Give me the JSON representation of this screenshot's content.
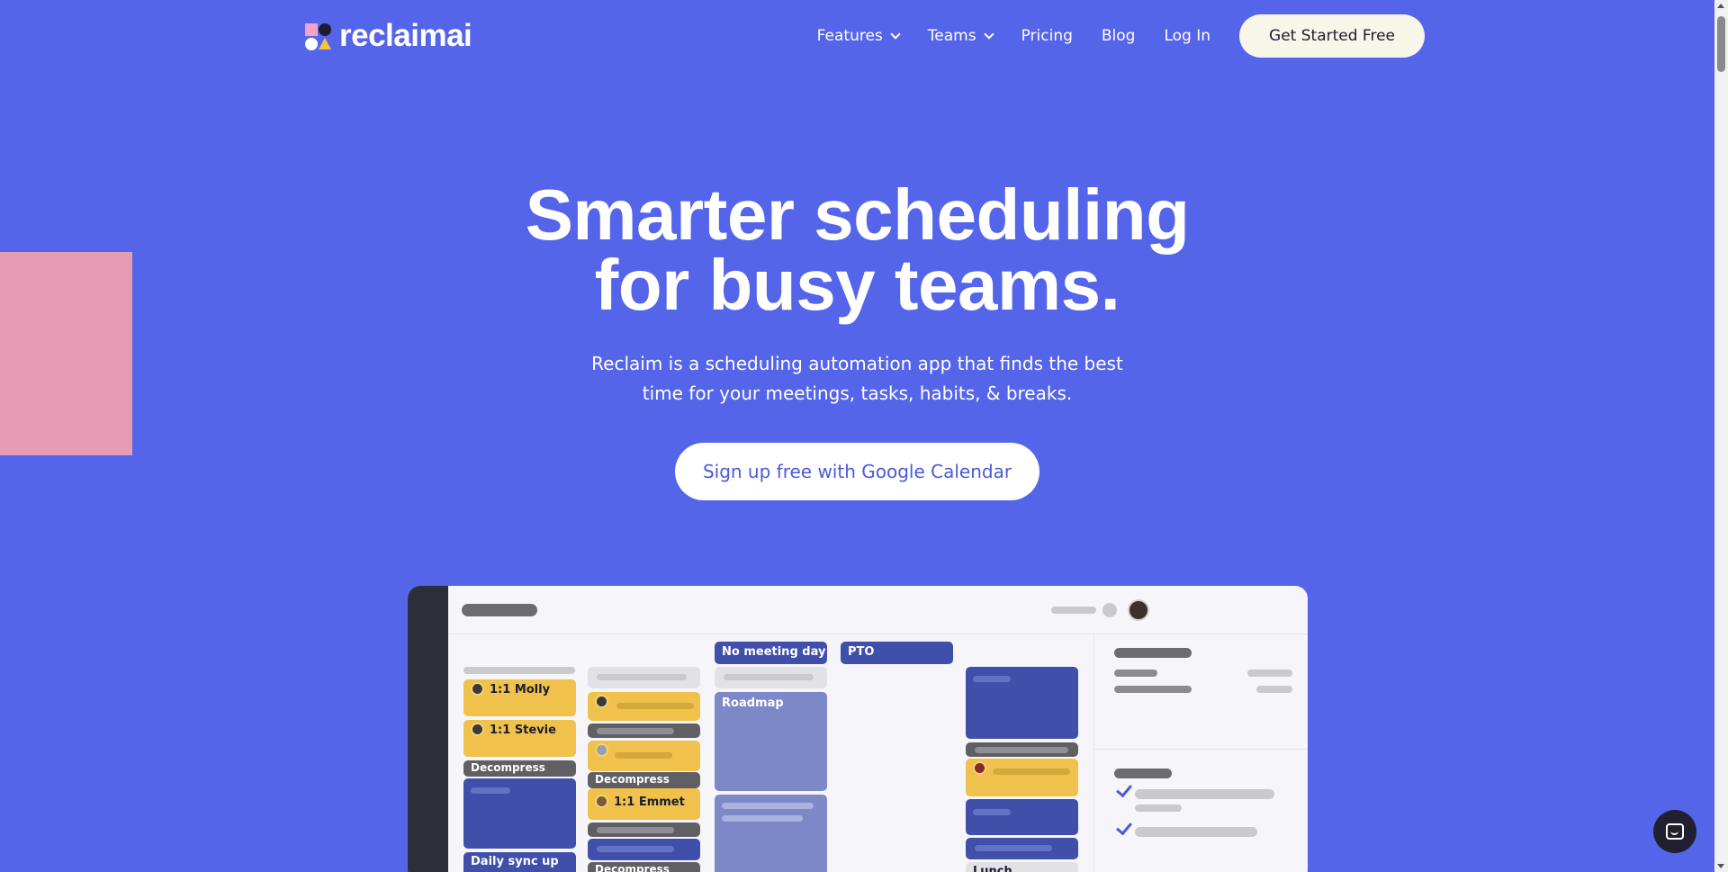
{
  "brand": {
    "name": "reclaimai"
  },
  "nav": {
    "items": [
      {
        "label": "Features",
        "dropdown": true
      },
      {
        "label": "Teams",
        "dropdown": true
      },
      {
        "label": "Pricing",
        "dropdown": false
      },
      {
        "label": "Blog",
        "dropdown": false
      },
      {
        "label": "Log In",
        "dropdown": false
      }
    ],
    "cta": "Get Started Free"
  },
  "hero": {
    "title_line1": "Smarter scheduling",
    "title_line2": "for busy teams.",
    "subtitle_line1": "Reclaim is a scheduling automation app that finds the best",
    "subtitle_line2": "time for your meetings, tasks, habits, & breaks.",
    "cta": "Sign up free with Google Calendar"
  },
  "mock": {
    "events": {
      "molly": "1:1 Molly",
      "stevie": "1:1 Stevie",
      "decompress": "Decompress",
      "daily_sync": "Daily sync up",
      "emmet": "1:1 Emmet",
      "no_meeting": "No meeting day",
      "pto": "PTO",
      "roadmap": "Roadmap",
      "lunch": "Lunch"
    }
  },
  "colors": {
    "background": "#5565ea",
    "pink": "#e69cb5",
    "cta_bg": "#f8f5e9",
    "event_yellow": "#f0c24b",
    "event_blue": "#3f4faa",
    "event_light_blue": "#7d88c9",
    "event_gray": "#5f5f64"
  },
  "icons": {
    "nav_dropdown": "chevron-down-icon",
    "chat": "chat-icon",
    "task_done": "check-icon"
  }
}
